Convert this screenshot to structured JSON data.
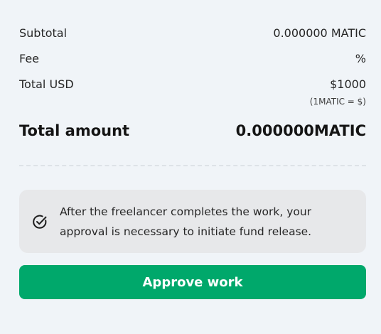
{
  "summary": {
    "subtotal_label": "Subtotal",
    "subtotal_value": "0.000000 MATIC",
    "fee_label": "Fee",
    "fee_value": "%",
    "total_usd_label": "Total USD",
    "total_usd_value": "$1000",
    "rate_note": "(1MATIC = $)"
  },
  "total": {
    "label": "Total amount",
    "value": "0.000000MATIC"
  },
  "notice": {
    "icon": "check-circle-icon",
    "text": "After the freelancer completes the work, your approval is necessary to initiate fund release."
  },
  "actions": {
    "approve_label": "Approve work"
  },
  "colors": {
    "background": "#f0f4f8",
    "notice_background": "#e7e8ea",
    "accent": "#00a86b",
    "divider": "#dde2e7"
  }
}
